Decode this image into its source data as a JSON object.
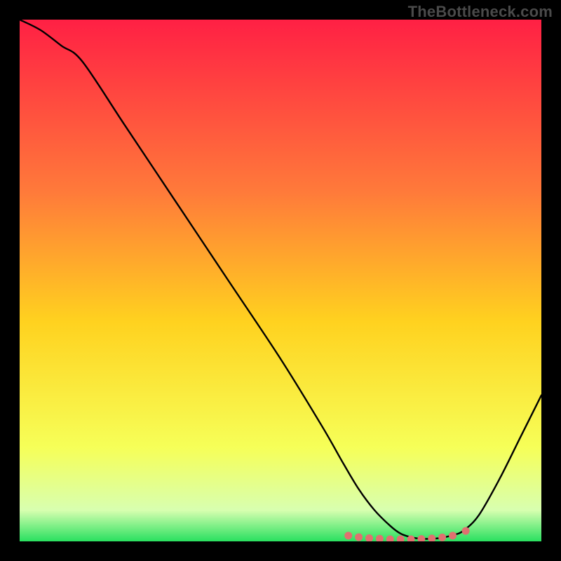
{
  "watermark": {
    "text": "TheBottleneck.com"
  },
  "colors": {
    "frame": "#000000",
    "curve": "#000000",
    "markers": "#e07070",
    "gradient_top": "#ff2044",
    "gradient_mid_upper": "#ff7a3a",
    "gradient_mid": "#ffd21f",
    "gradient_mid_lower": "#f6ff58",
    "gradient_footband": "#d8ffb0",
    "gradient_bottom": "#29e060"
  },
  "chart_data": {
    "type": "line",
    "title": "",
    "xlabel": "",
    "ylabel": "",
    "xlim": [
      0,
      100
    ],
    "ylim": [
      0,
      100
    ],
    "x": [
      0,
      4,
      8,
      12,
      20,
      30,
      40,
      50,
      58,
      62,
      65,
      68,
      71,
      73,
      75,
      77,
      79,
      81,
      83,
      85,
      88,
      92,
      96,
      100
    ],
    "values": [
      100,
      98,
      95,
      92,
      80,
      65,
      50,
      35,
      22,
      15,
      10,
      6,
      3,
      1.5,
      0.8,
      0.5,
      0.5,
      0.7,
      1.2,
      2,
      5,
      12,
      20,
      28
    ],
    "marker_points": [
      {
        "x": 63,
        "y": 1.1
      },
      {
        "x": 65,
        "y": 0.8
      },
      {
        "x": 67,
        "y": 0.6
      },
      {
        "x": 69,
        "y": 0.5
      },
      {
        "x": 71,
        "y": 0.4
      },
      {
        "x": 73,
        "y": 0.4
      },
      {
        "x": 75,
        "y": 0.4
      },
      {
        "x": 77,
        "y": 0.45
      },
      {
        "x": 79,
        "y": 0.55
      },
      {
        "x": 81,
        "y": 0.75
      },
      {
        "x": 83,
        "y": 1.1
      },
      {
        "x": 85.5,
        "y": 2.0
      }
    ]
  }
}
